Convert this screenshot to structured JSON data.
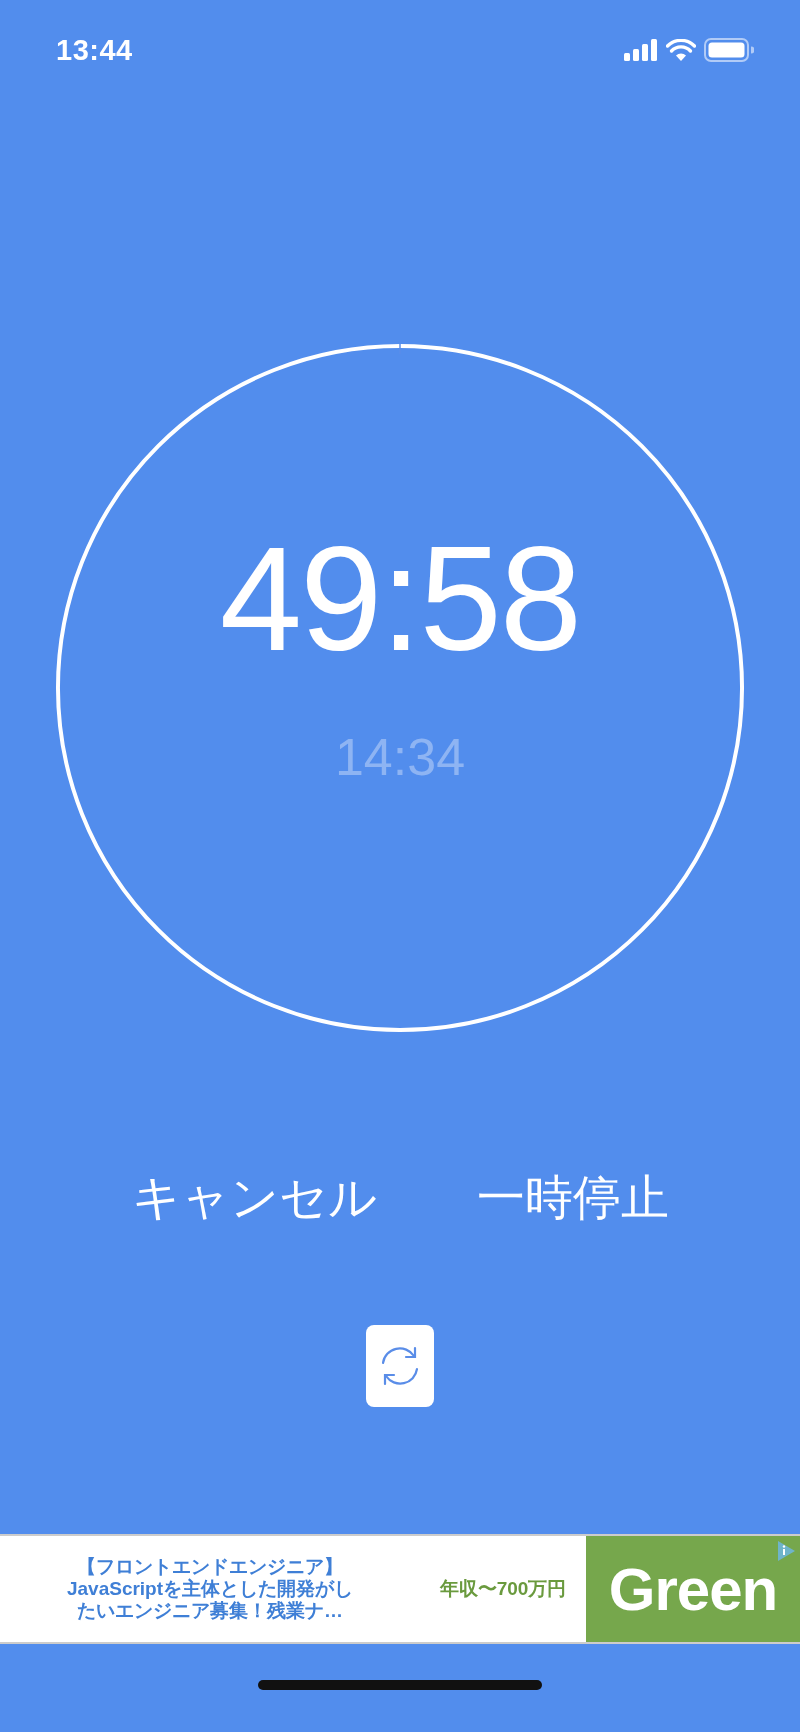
{
  "status_bar": {
    "time": "13:44"
  },
  "timer": {
    "remaining": "49:58",
    "end_time": "14:34"
  },
  "buttons": [
    {
      "label": "キャンセル"
    },
    {
      "label": "一時停止"
    }
  ],
  "ad": {
    "headline": "【フロントエンドエンジニア】",
    "body": "JavaScriptを主体とした開発がしたいエンジニア募集！残業ナ…",
    "salary": "年収〜700万円",
    "logo": "Green"
  }
}
